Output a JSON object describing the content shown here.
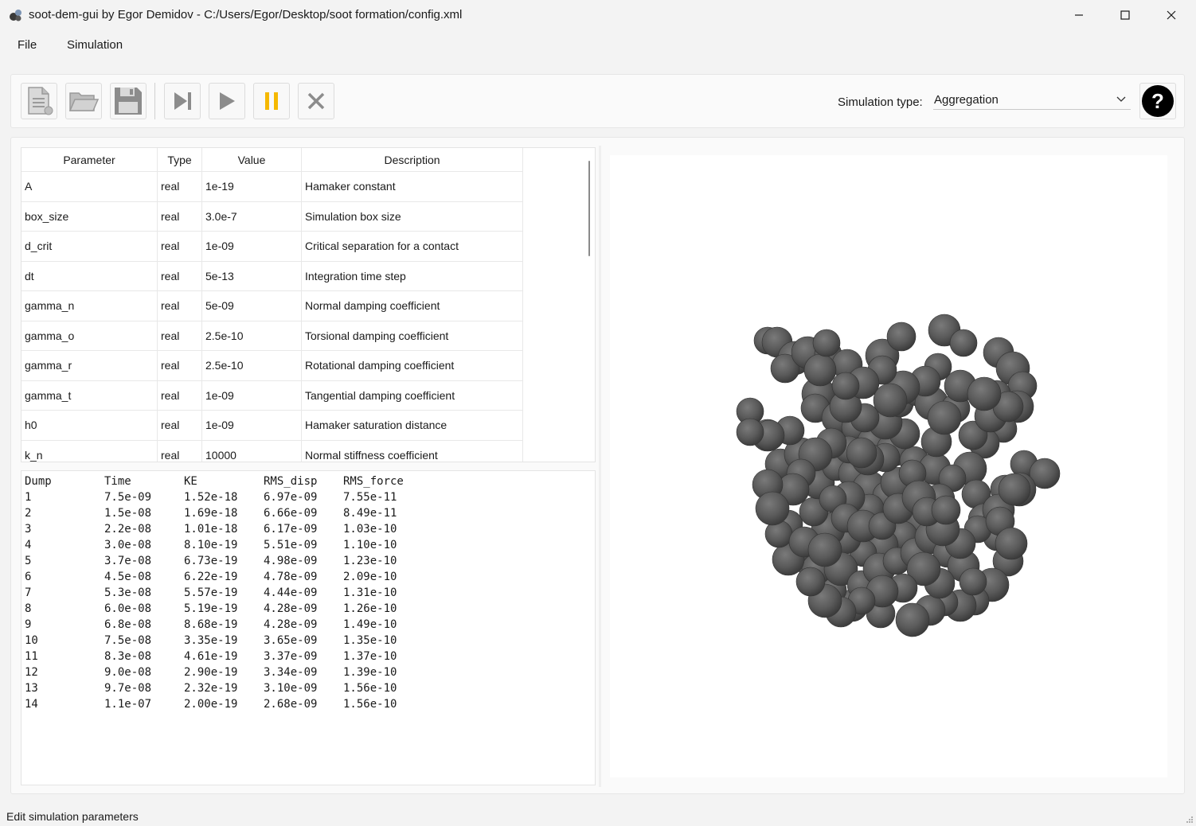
{
  "window": {
    "title": "soot-dem-gui by Egor Demidov - C:/Users/Egor/Desktop/soot formation/config.xml"
  },
  "menu": {
    "items": [
      {
        "label": "File"
      },
      {
        "label": "Simulation"
      }
    ]
  },
  "toolbar": {
    "buttons": [
      {
        "icon": "new-file-icon"
      },
      {
        "icon": "open-folder-icon"
      },
      {
        "icon": "save-icon"
      },
      {
        "icon": "step-icon"
      },
      {
        "icon": "play-icon"
      },
      {
        "icon": "pause-icon"
      },
      {
        "icon": "stop-icon"
      }
    ],
    "simulation_type_label": "Simulation type:",
    "simulation_type_value": "Aggregation",
    "help_label": "?"
  },
  "params": {
    "headers": {
      "parameter": "Parameter",
      "type": "Type",
      "value": "Value",
      "description": "Description"
    },
    "rows": [
      {
        "parameter": "A",
        "type": "real",
        "value": "1e-19",
        "description": "Hamaker constant"
      },
      {
        "parameter": "box_size",
        "type": "real",
        "value": "3.0e-7",
        "description": "Simulation box size"
      },
      {
        "parameter": "d_crit",
        "type": "real",
        "value": "1e-09",
        "description": "Critical separation for a contact"
      },
      {
        "parameter": "dt",
        "type": "real",
        "value": "5e-13",
        "description": "Integration time step"
      },
      {
        "parameter": "gamma_n",
        "type": "real",
        "value": "5e-09",
        "description": "Normal damping coefficient"
      },
      {
        "parameter": "gamma_o",
        "type": "real",
        "value": "2.5e-10",
        "description": "Torsional damping coefficient"
      },
      {
        "parameter": "gamma_r",
        "type": "real",
        "value": "2.5e-10",
        "description": "Rotational damping coefficient"
      },
      {
        "parameter": "gamma_t",
        "type": "real",
        "value": "1e-09",
        "description": "Tangential damping coefficient"
      },
      {
        "parameter": "h0",
        "type": "real",
        "value": "1e-09",
        "description": "Hamaker saturation distance"
      },
      {
        "parameter": "k_n",
        "type": "real",
        "value": "10000",
        "description": "Normal stiffness coefficient"
      }
    ]
  },
  "log": {
    "headers": [
      "Dump",
      "Time",
      "KE",
      "RMS_disp",
      "RMS_force"
    ],
    "rows": [
      [
        "1",
        "7.5e-09",
        "1.52e-18",
        "6.97e-09",
        "7.55e-11"
      ],
      [
        "2",
        "1.5e-08",
        "1.69e-18",
        "6.66e-09",
        "8.49e-11"
      ],
      [
        "3",
        "2.2e-08",
        "1.01e-18",
        "6.17e-09",
        "1.03e-10"
      ],
      [
        "4",
        "3.0e-08",
        "8.10e-19",
        "5.51e-09",
        "1.10e-10"
      ],
      [
        "5",
        "3.7e-08",
        "6.73e-19",
        "4.98e-09",
        "1.23e-10"
      ],
      [
        "6",
        "4.5e-08",
        "6.22e-19",
        "4.78e-09",
        "2.09e-10"
      ],
      [
        "7",
        "5.3e-08",
        "5.57e-19",
        "4.44e-09",
        "1.31e-10"
      ],
      [
        "8",
        "6.0e-08",
        "5.19e-19",
        "4.28e-09",
        "1.26e-10"
      ],
      [
        "9",
        "6.8e-08",
        "8.68e-19",
        "4.28e-09",
        "1.49e-10"
      ],
      [
        "10",
        "7.5e-08",
        "3.35e-19",
        "3.65e-09",
        "1.35e-10"
      ],
      [
        "11",
        "8.3e-08",
        "4.61e-19",
        "3.37e-09",
        "1.37e-10"
      ],
      [
        "12",
        "9.0e-08",
        "2.90e-19",
        "3.34e-09",
        "1.39e-10"
      ],
      [
        "13",
        "9.7e-08",
        "2.32e-19",
        "3.10e-09",
        "1.56e-10"
      ],
      [
        "14",
        "1.1e-07",
        "2.00e-19",
        "2.68e-09",
        "1.56e-10"
      ]
    ]
  },
  "viewport": {
    "particle_color": "#5a5a5a"
  },
  "status": {
    "text": "Edit simulation parameters"
  },
  "colors": {
    "pause_accent": "#f5b800",
    "disabled_icon": "#9a9a9a"
  }
}
